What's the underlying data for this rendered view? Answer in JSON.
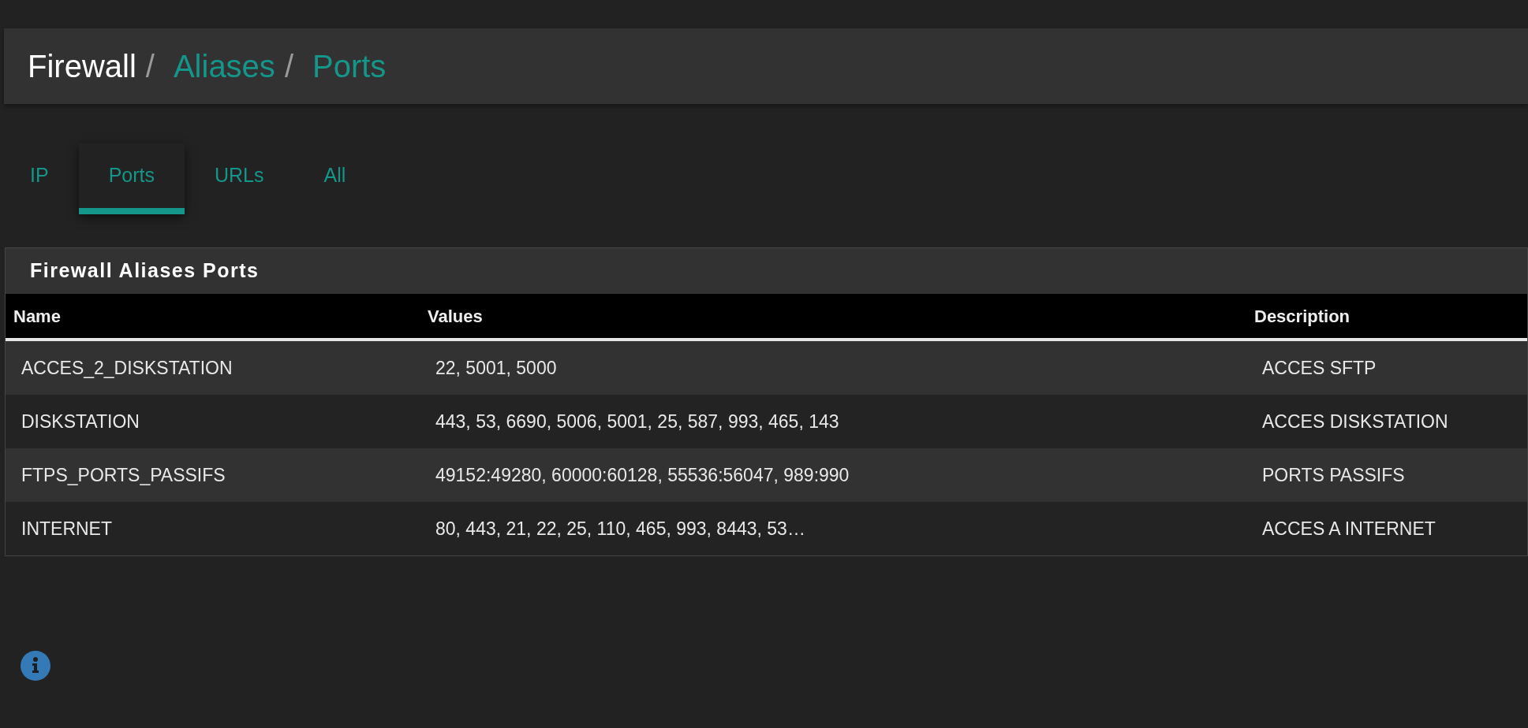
{
  "breadcrumb": [
    {
      "label": "Firewall",
      "kind": "root"
    },
    {
      "label": "Aliases",
      "kind": "link"
    },
    {
      "label": "Ports",
      "kind": "link"
    }
  ],
  "separator": "/",
  "tabs": [
    {
      "label": "IP",
      "selected": false
    },
    {
      "label": "Ports",
      "selected": true
    },
    {
      "label": "URLs",
      "selected": false
    },
    {
      "label": "All",
      "selected": false
    }
  ],
  "panel": {
    "title": "Firewall Aliases Ports",
    "columns": [
      "Name",
      "Values",
      "Description"
    ],
    "rows": [
      [
        "ACCES_2_DISKSTATION",
        "22, 5001, 5000",
        "ACCES SFTP"
      ],
      [
        "DISKSTATION",
        "443, 53, 6690, 5006, 5001, 25, 587, 993, 465, 143",
        "ACCES DISKSTATION"
      ],
      [
        "FTPS_PORTS_PASSIFS",
        "49152:49280, 60000:60128, 55536:56047, 989:990",
        "PORTS PASSIFS"
      ],
      [
        "INTERNET",
        "80, 443, 21, 22, 25, 110, 465, 993, 8443, 53…",
        "ACCES A INTERNET"
      ]
    ]
  }
}
